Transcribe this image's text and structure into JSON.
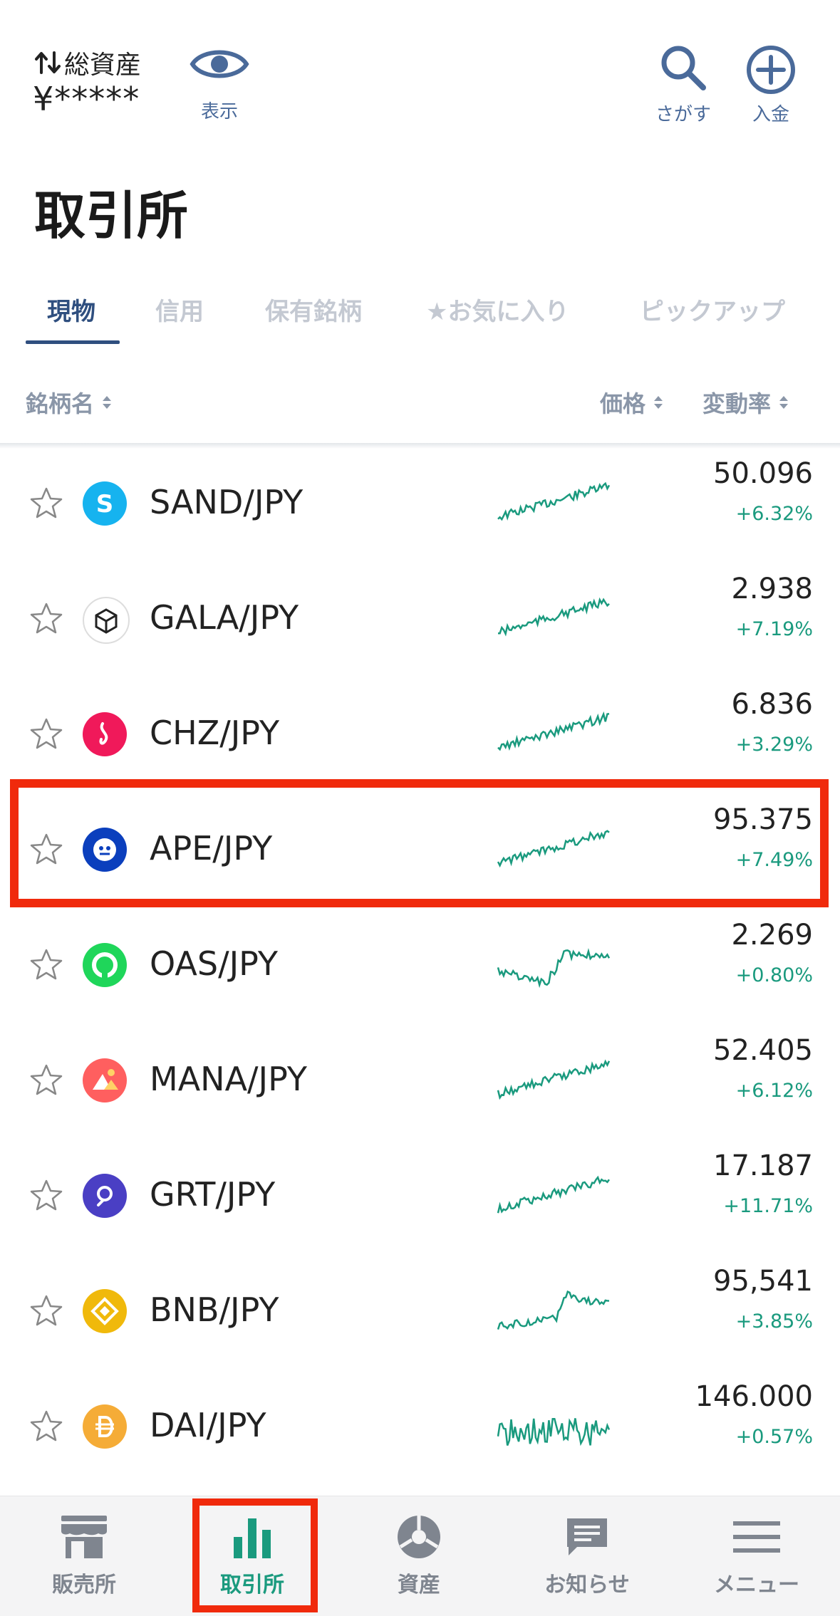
{
  "header": {
    "total_assets_label": "総資産",
    "total_assets_value": "¥*****",
    "show_label": "表示",
    "search_label": "さがす",
    "deposit_label": "入金"
  },
  "page_title": "取引所",
  "tabs": [
    {
      "label": "現物"
    },
    {
      "label": "信用"
    },
    {
      "label": "保有銘柄"
    },
    {
      "label": "★お気に入り"
    },
    {
      "label": "ピックアップ"
    }
  ],
  "columns": {
    "name": "銘柄名",
    "price": "価格",
    "change": "変動率"
  },
  "colors": {
    "up": "#1a9a7e",
    "accent": "#2f4f7f",
    "highlight": "#f02a0c"
  },
  "rows": [
    {
      "pair": "SAND/JPY",
      "price": "50.096",
      "change": "+6.32%",
      "icon": "sand-coin-icon",
      "color": "#16b3ef"
    },
    {
      "pair": "GALA/JPY",
      "price": "2.938",
      "change": "+7.19%",
      "icon": "gala-coin-icon",
      "color": "#ffffff"
    },
    {
      "pair": "CHZ/JPY",
      "price": "6.836",
      "change": "+3.29%",
      "icon": "chz-coin-icon",
      "color": "#f0195a"
    },
    {
      "pair": "APE/JPY",
      "price": "95.375",
      "change": "+7.49%",
      "icon": "ape-coin-icon",
      "color": "#0b3fbd"
    },
    {
      "pair": "OAS/JPY",
      "price": "2.269",
      "change": "+0.80%",
      "icon": "oas-coin-icon",
      "color": "#1fd65a"
    },
    {
      "pair": "MANA/JPY",
      "price": "52.405",
      "change": "+6.12%",
      "icon": "mana-coin-icon",
      "color": "#ff5f5f"
    },
    {
      "pair": "GRT/JPY",
      "price": "17.187",
      "change": "+11.71%",
      "icon": "grt-coin-icon",
      "color": "#4a3fc4"
    },
    {
      "pair": "BNB/JPY",
      "price": "95,541",
      "change": "+3.85%",
      "icon": "bnb-coin-icon",
      "color": "#f0b90b"
    },
    {
      "pair": "DAI/JPY",
      "price": "146.000",
      "change": "+0.57%",
      "icon": "dai-coin-icon",
      "color": "#f5ac37"
    }
  ],
  "nav": [
    {
      "label": "販売所",
      "icon": "store-icon"
    },
    {
      "label": "取引所",
      "icon": "bar-chart-icon"
    },
    {
      "label": "資産",
      "icon": "pie-chart-icon"
    },
    {
      "label": "お知らせ",
      "icon": "message-icon"
    },
    {
      "label": "メニュー",
      "icon": "menu-icon"
    }
  ]
}
